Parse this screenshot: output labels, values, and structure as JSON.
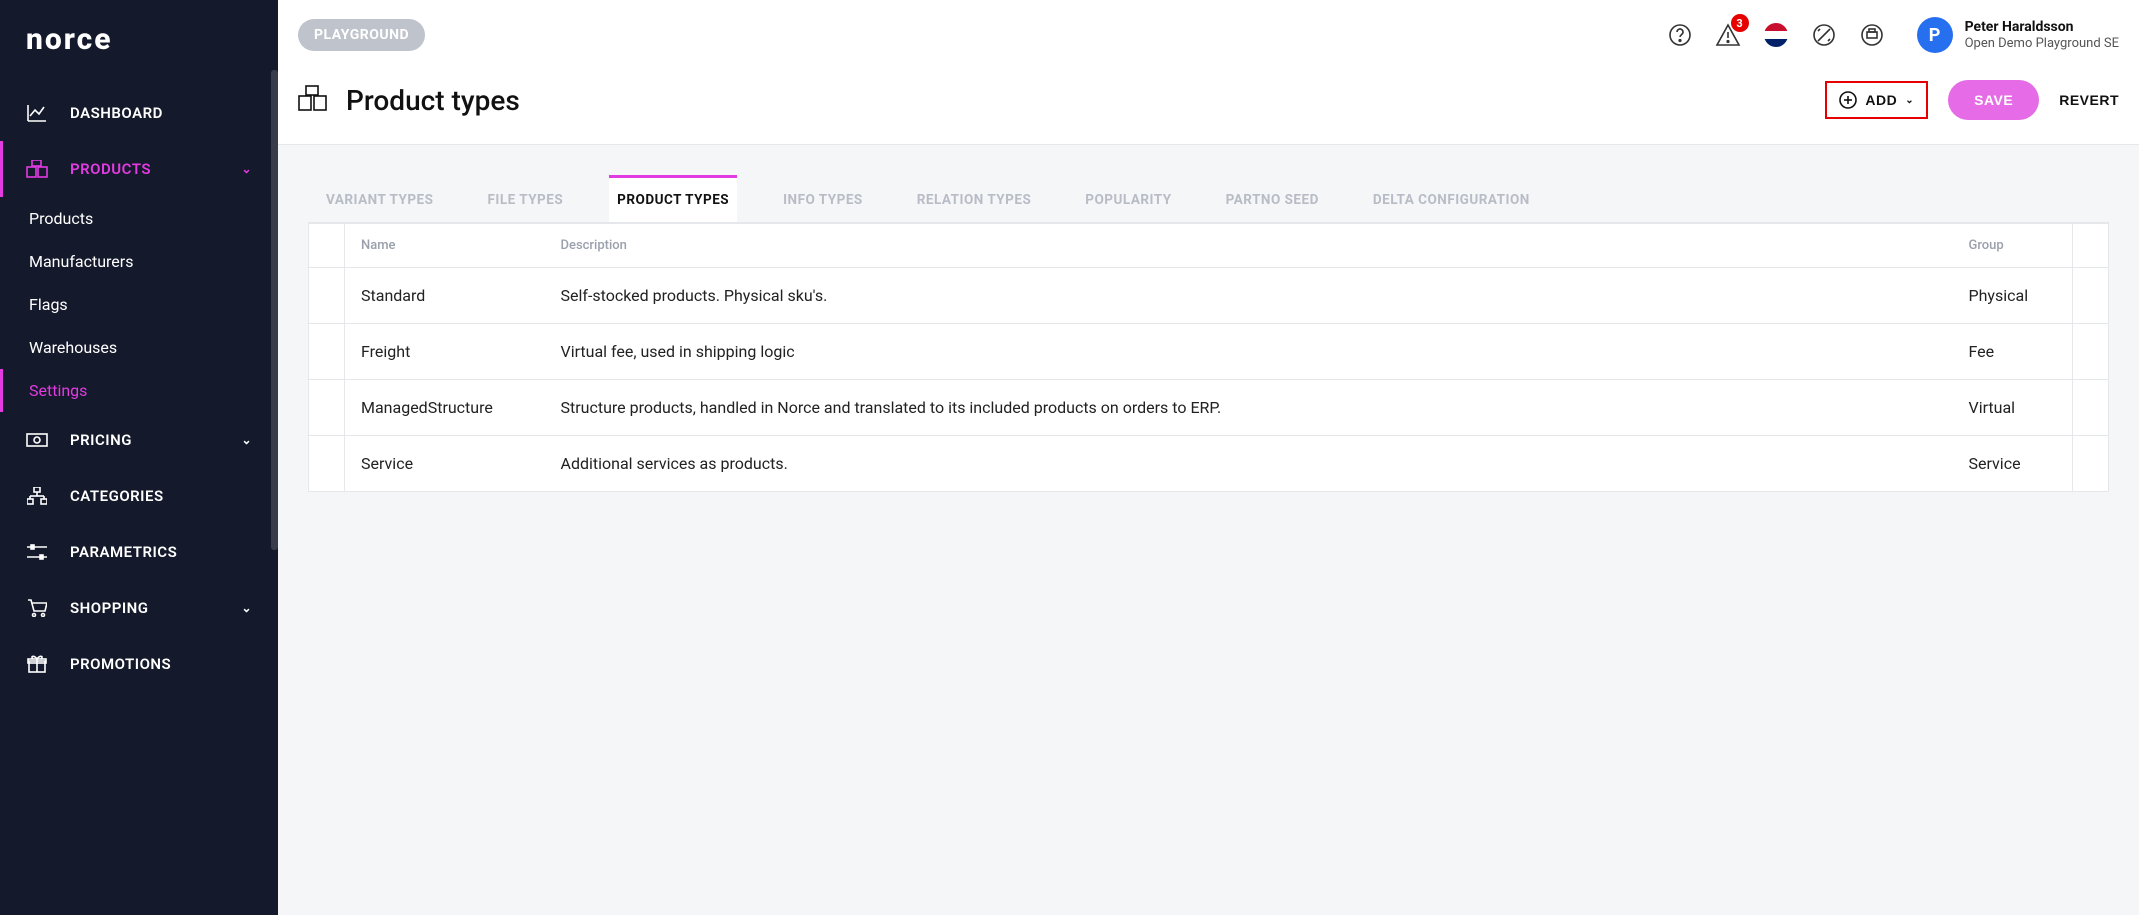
{
  "brand": "norce",
  "topbar": {
    "pill": "PLAYGROUND",
    "notification_count": "3",
    "user": {
      "initial": "P",
      "name": "Peter Haraldsson",
      "sub": "Open Demo Playground SE"
    }
  },
  "sidebar": {
    "items": [
      {
        "label": "DASHBOARD",
        "icon": "chart"
      },
      {
        "label": "PRODUCTS",
        "icon": "product",
        "active": true,
        "expandable": true,
        "children": [
          {
            "label": "Products"
          },
          {
            "label": "Manufacturers"
          },
          {
            "label": "Flags"
          },
          {
            "label": "Warehouses"
          },
          {
            "label": "Settings",
            "active": true
          }
        ]
      },
      {
        "label": "PRICING",
        "icon": "money",
        "expandable": true
      },
      {
        "label": "CATEGORIES",
        "icon": "tree"
      },
      {
        "label": "PARAMETRICS",
        "icon": "sliders"
      },
      {
        "label": "SHOPPING",
        "icon": "cart",
        "expandable": true
      },
      {
        "label": "PROMOTIONS",
        "icon": "gift"
      }
    ]
  },
  "page": {
    "title": "Product types",
    "add_label": "ADD",
    "save_label": "SAVE",
    "revert_label": "REVERT"
  },
  "tabs": [
    {
      "label": "VARIANT TYPES"
    },
    {
      "label": "FILE TYPES"
    },
    {
      "label": "PRODUCT TYPES",
      "active": true
    },
    {
      "label": "INFO TYPES"
    },
    {
      "label": "RELATION TYPES"
    },
    {
      "label": "POPULARITY"
    },
    {
      "label": "PARTNO SEED"
    },
    {
      "label": "DELTA CONFIGURATION"
    }
  ],
  "table": {
    "headers": {
      "name": "Name",
      "description": "Description",
      "group": "Group"
    },
    "rows": [
      {
        "name": "Standard",
        "description": "Self-stocked products. Physical sku's.",
        "group": "Physical"
      },
      {
        "name": "Freight",
        "description": "Virtual fee, used in shipping logic",
        "group": "Fee"
      },
      {
        "name": "ManagedStructure",
        "description": "Structure products, handled in Norce and translated to its included products on orders to ERP.",
        "group": "Virtual"
      },
      {
        "name": "Service",
        "description": "Additional services as products.",
        "group": "Service"
      }
    ]
  }
}
